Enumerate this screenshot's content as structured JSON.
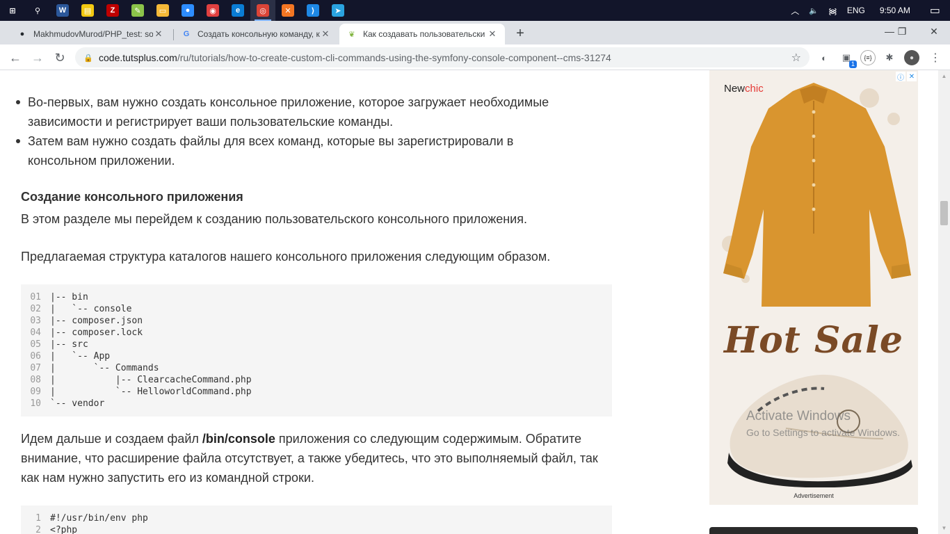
{
  "taskbar": {
    "icons": [
      {
        "name": "windows-start-icon",
        "glyph": "⊞",
        "color": "#12152a"
      },
      {
        "name": "search-icon",
        "glyph": "⚲",
        "color": "#12152a"
      },
      {
        "name": "word-icon",
        "glyph": "W",
        "color": "#2b579a"
      },
      {
        "name": "sticky-notes-icon",
        "glyph": "▤",
        "color": "#f2c811"
      },
      {
        "name": "filezilla-icon",
        "glyph": "Z",
        "color": "#bf0000"
      },
      {
        "name": "app-yellow-icon",
        "glyph": "✎",
        "color": "#8bc34a"
      },
      {
        "name": "file-explorer-icon",
        "glyph": "▭",
        "color": "#f5b938"
      },
      {
        "name": "zoom-icon",
        "glyph": "●",
        "color": "#2d8cff"
      },
      {
        "name": "app-satellite-icon",
        "glyph": "◉",
        "color": "#e04040"
      },
      {
        "name": "edge-icon",
        "glyph": "e",
        "color": "#0a7cd4"
      },
      {
        "name": "chrome-icon",
        "glyph": "◎",
        "color": "#db4437"
      },
      {
        "name": "xampp-icon",
        "glyph": "✕",
        "color": "#f37623"
      },
      {
        "name": "vscode-icon",
        "glyph": "⟩",
        "color": "#1e88e5"
      },
      {
        "name": "telegram-icon",
        "glyph": "➤",
        "color": "#2aa3e0"
      }
    ],
    "tray": {
      "chevron": "︿",
      "volume": "🔈",
      "network": "᯼",
      "language": "ENG",
      "time": "9:50 AM",
      "notifications": "▭"
    }
  },
  "tabs": [
    {
      "title": "MakhmudovMurod/PHP_test: so",
      "favicon": "github-icon",
      "fav_glyph": "●",
      "active": false
    },
    {
      "title": "Создать консольную команду, к",
      "favicon": "google-icon",
      "fav_glyph": "G",
      "active": false
    },
    {
      "title": "Как создавать пользовательски",
      "favicon": "envato-tuts-icon",
      "fav_glyph": "❦",
      "active": true
    }
  ],
  "new_tab": "+",
  "window": {
    "minimize": "—",
    "maximize": "❐",
    "close": "✕"
  },
  "toolbar": {
    "back": "←",
    "forward": "→",
    "reload": "↻",
    "url_host": "code.tutsplus.com",
    "url_path": "/ru/tutorials/how-to-create-custom-cli-commands-using-the-symfony-console-component--cms-31274",
    "bookmark": "☆",
    "extension_badge": "1"
  },
  "article": {
    "bullets": [
      "Во-первых, вам нужно создать консольное приложение, которое загружает необходимые зависимости и регистрирует ваши пользовательские команды.",
      "Затем вам нужно создать файлы для всех команд, которые вы зарегистрировали в консольном приложении."
    ],
    "heading": "Создание консольного приложения",
    "intro": "В этом разделе мы перейдем к созданию пользовательского консольного приложения.",
    "structure_intro": "Предлагаемая структура каталогов нашего консольного приложения следующим образом.",
    "code1": [
      {
        "ln": "01",
        "src": "|-- bin"
      },
      {
        "ln": "02",
        "src": "|   `-- console"
      },
      {
        "ln": "03",
        "src": "|-- composer.json"
      },
      {
        "ln": "04",
        "src": "|-- composer.lock"
      },
      {
        "ln": "05",
        "src": "|-- src"
      },
      {
        "ln": "06",
        "src": "|   `-- App"
      },
      {
        "ln": "07",
        "src": "|       `-- Commands"
      },
      {
        "ln": "08",
        "src": "|           |-- ClearcacheCommand.php"
      },
      {
        "ln": "09",
        "src": "|           `-- HelloworldCommand.php"
      },
      {
        "ln": "10",
        "src": "`-- vendor"
      }
    ],
    "para2_before": "Идем дальше и создаем файл ",
    "para2_bold": "/bin/console",
    "para2_after": " приложения со следующим содержимым. Обратите внимание, что расширение файла отсутствует, а также убедитесь, что это выполняемый файл, так как нам нужно запустить его из командной строки.",
    "code2": [
      {
        "ln": "1",
        "src": "#!/usr/bin/env php"
      },
      {
        "ln": "2",
        "src": "<?php"
      }
    ]
  },
  "ad": {
    "brand_prefix": "New",
    "brand_suffix": "chic",
    "headline": "Hot Sale",
    "label": "Advertisement",
    "info_icon": "ⓘ",
    "close_icon": "✕"
  },
  "watermark": {
    "line1": "Activate Windows",
    "line2": "Go to Settings to activate Windows."
  },
  "colors": {
    "taskbar": "#12152a",
    "tabstrip": "#dee1e6",
    "code_bg": "#f5f5f5",
    "shirt": "#d9952f",
    "headline": "#7a4a26"
  }
}
